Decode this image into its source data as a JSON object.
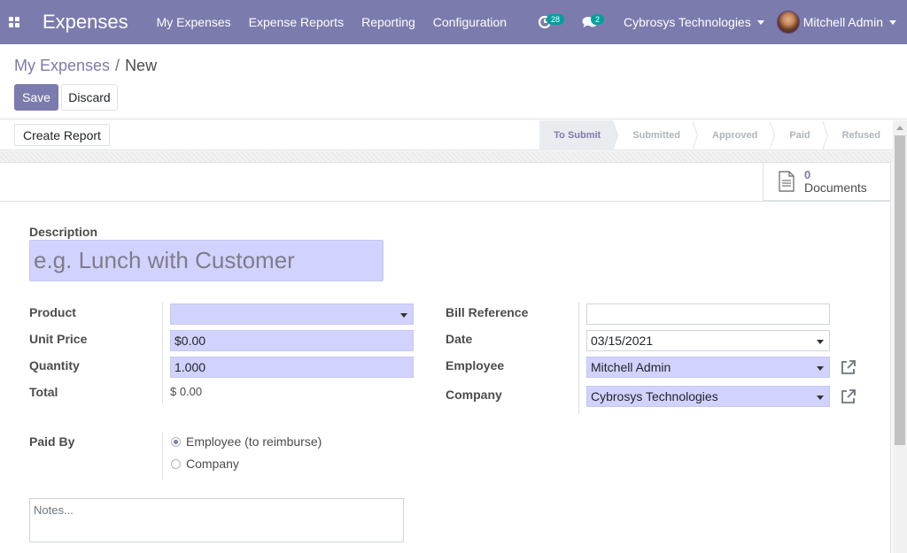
{
  "navbar": {
    "app_name": "Expenses",
    "menu": [
      {
        "label": "My Expenses"
      },
      {
        "label": "Expense Reports"
      },
      {
        "label": "Reporting"
      },
      {
        "label": "Configuration"
      }
    ],
    "activity_count": "28",
    "message_count": "2",
    "company": "Cybrosys Technologies",
    "user": "Mitchell Admin"
  },
  "breadcrumb": {
    "parent": "My Expenses",
    "separator": "/",
    "current": "New"
  },
  "buttons": {
    "save": "Save",
    "discard": "Discard",
    "create_report": "Create Report"
  },
  "stages": [
    {
      "label": "To Submit",
      "active": true
    },
    {
      "label": "Submitted",
      "active": false
    },
    {
      "label": "Approved",
      "active": false
    },
    {
      "label": "Paid",
      "active": false
    },
    {
      "label": "Refused",
      "active": false
    }
  ],
  "documents": {
    "count": "0",
    "label": "Documents"
  },
  "form": {
    "description_label": "Description",
    "description_placeholder": "e.g. Lunch with Customer",
    "product_label": "Product",
    "product_value": "",
    "unit_price_label": "Unit Price",
    "unit_price_value": "$0.00",
    "quantity_label": "Quantity",
    "quantity_value": "1.000",
    "total_label": "Total",
    "total_value": "$ 0.00",
    "bill_reference_label": "Bill Reference",
    "bill_reference_value": "",
    "date_label": "Date",
    "date_value": "03/15/2021",
    "employee_label": "Employee",
    "employee_value": "Mitchell Admin",
    "company_label": "Company",
    "company_value": "Cybrosys Technologies",
    "paid_by_label": "Paid By",
    "paid_by_options": [
      {
        "label": "Employee (to reimburse)",
        "checked": true
      },
      {
        "label": "Company",
        "checked": false
      }
    ],
    "notes_placeholder": "Notes..."
  },
  "colors": {
    "brand": "#7c7bad",
    "required_field": "#d2d2ff",
    "badge": "#00a09d"
  }
}
